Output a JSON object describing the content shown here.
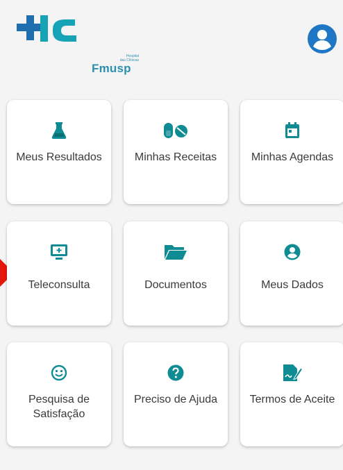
{
  "header": {
    "logo": {
      "line1": "Hospital",
      "line2": "das Clínicas",
      "brand": "Fmusp"
    },
    "profile_icon": "account-circle-icon"
  },
  "menu": [
    {
      "label": "Meus Resultados",
      "icon": "flask-icon"
    },
    {
      "label": "Minhas Receitas",
      "icon": "pills-icon"
    },
    {
      "label": "Minhas Agendas",
      "icon": "calendar-icon"
    },
    {
      "label": "Teleconsulta",
      "icon": "monitor-plus-icon"
    },
    {
      "label": "Documentos",
      "icon": "folder-open-icon"
    },
    {
      "label": "Meus Dados",
      "icon": "account-circle-icon"
    },
    {
      "label": "Pesquisa de Satisfação",
      "icon": "smiley-icon"
    },
    {
      "label": "Preciso de Ajuda",
      "icon": "help-circle-icon"
    },
    {
      "label": "Termos de Aceite",
      "icon": "document-sign-icon"
    }
  ],
  "colors": {
    "brand_blue": "#2b8fae",
    "icon_teal": "#0e8b93",
    "profile_blue": "#1f76c2",
    "indicator_red": "#e3170a"
  }
}
